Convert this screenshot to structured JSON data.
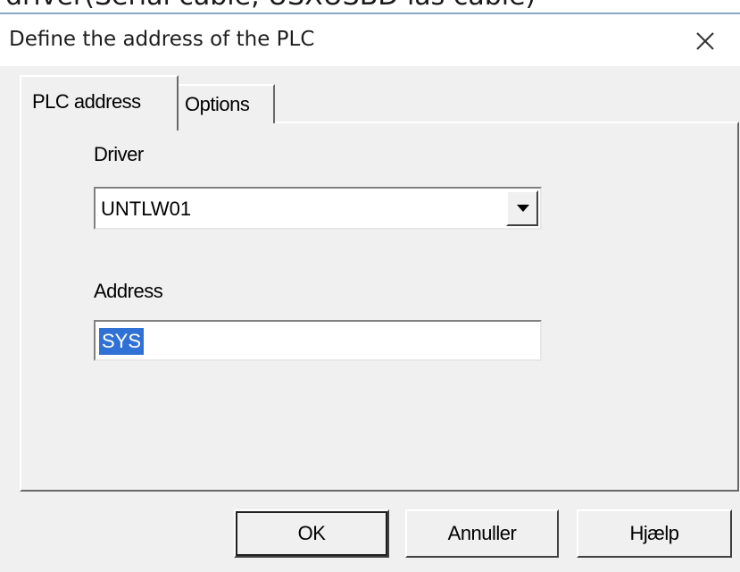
{
  "background_text": "driver(Serial cable, USXUSBD las cable)",
  "dialog": {
    "title": "Define the address of the PLC",
    "close_icon": "close-x-icon"
  },
  "tabs": [
    {
      "label": "PLC address",
      "active": true
    },
    {
      "label": "Options",
      "active": false
    }
  ],
  "driver": {
    "label": "Driver",
    "value": "UNTLW01",
    "dropdown_icon": "chevron-down-icon"
  },
  "address": {
    "label": "Address",
    "value": "SYS"
  },
  "buttons": {
    "ok": "OK",
    "cancel": "Annuller",
    "help": "Hjælp"
  },
  "colors": {
    "selection": "#3071d5",
    "dialog_bg": "#f0f0f0"
  }
}
